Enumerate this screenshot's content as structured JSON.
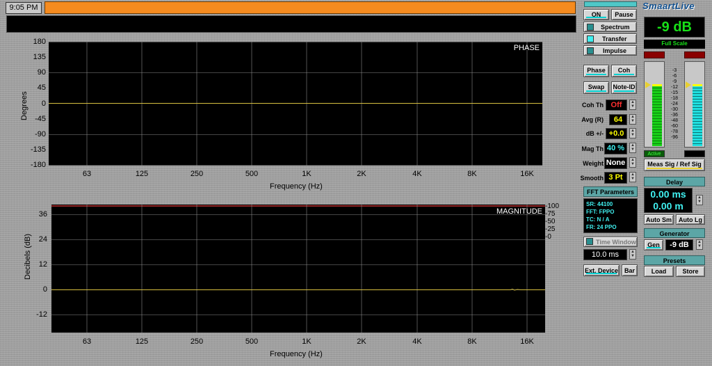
{
  "header": {
    "time": "9:05 PM"
  },
  "phase_plot": {
    "label": "PHASE",
    "y_title": "Degrees",
    "y_ticks": [
      "180",
      "135",
      "90",
      "45",
      "0",
      "-45",
      "-90",
      "-135",
      "-180"
    ],
    "x_title": "Frequency (Hz)",
    "x_ticks": [
      "63",
      "125",
      "250",
      "500",
      "1K",
      "2K",
      "4K",
      "8K",
      "16K"
    ]
  },
  "magnitude_plot": {
    "label": "MAGNITUDE",
    "y_title": "Decibels (dB)",
    "y_ticks": [
      "36",
      "24",
      "12",
      "0",
      "-12"
    ],
    "right_ticks": [
      "100",
      "75",
      "50",
      "25",
      "0"
    ],
    "x_title": "Frequency (Hz)",
    "x_ticks": [
      "63",
      "125",
      "250",
      "500",
      "1K",
      "2K",
      "4K",
      "8K",
      "16K"
    ]
  },
  "controls": {
    "on": "ON",
    "pause": "Pause",
    "spectrum": "Spectrum",
    "transfer": "Transfer",
    "impulse": "Impulse",
    "phase": "Phase",
    "coh": "Coh",
    "swap": "Swap",
    "note_id": "Note-ID",
    "coh_th_label": "Coh Th",
    "coh_th_value": "Off",
    "avg_label": "Avg (R)",
    "avg_value": "64",
    "db_label": "dB +/-",
    "db_value": "+0.0",
    "mag_th_label": "Mag Th",
    "mag_th_value": "40 %",
    "weight_label": "Weight",
    "weight_value": "None",
    "smooth_label": "Smooth",
    "smooth_value": "3 Pt",
    "fft_title": "FFT Parameters",
    "fft_lines": [
      "SR: 44100",
      "FFT: FPPO",
      "TC: N / A",
      "FR: 24 PPO"
    ],
    "time_window": "Time Window",
    "time_window_value": "10.0 ms",
    "ext_device": "Ext. Device",
    "bar": "Bar"
  },
  "right_panel": {
    "logo": "SmaartLive",
    "level": "-9 dB",
    "full_scale": "Full Scale",
    "meter_scale": [
      "-3",
      "-6",
      "-9",
      "-12",
      "-15",
      "-18",
      "-24",
      "-30",
      "-36",
      "-48",
      "-60",
      "-78",
      "-96"
    ],
    "meter_levels": {
      "left": 0.72,
      "right": 0.72
    },
    "active": "Active",
    "meas_sig": "Meas Sig / Ref Sig",
    "delay_title": "Delay",
    "delay_ms": "0.00 ms",
    "delay_m": "0.00 m",
    "auto_sm": "Auto Sm",
    "auto_lg": "Auto Lg",
    "generator_title": "Generator",
    "gen": "Gen",
    "gen_level": "-9 dB",
    "presets_title": "Presets",
    "load": "Load",
    "store": "Store"
  },
  "colors": {
    "accent_orange": "#f58b1f",
    "teal": "#5ca6a6",
    "cyan": "#00e0e0",
    "yellow_value": "#ffff00",
    "red_value": "#ff3030",
    "meter_green": "#18d018",
    "meter_cyan": "#20e0e0"
  }
}
